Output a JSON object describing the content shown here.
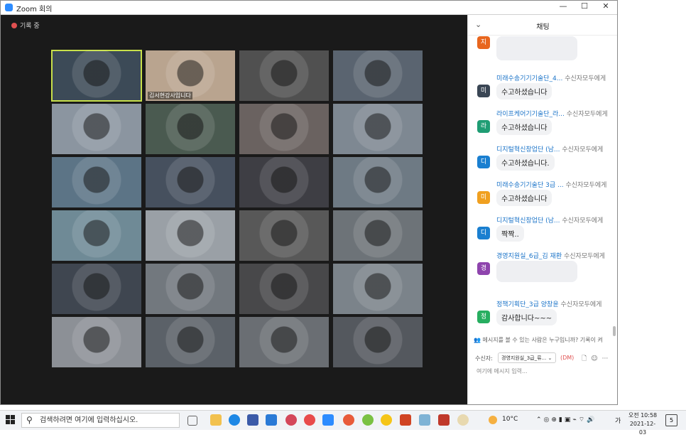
{
  "window": {
    "title": "Zoom 회의",
    "minimize": "—",
    "maximize": "☐",
    "close": "✕"
  },
  "meeting": {
    "recording_label": "기록 중",
    "featured_name": "김서현강사입니다",
    "tiles": [
      {
        "name": "",
        "color": "#3c4a57"
      },
      {
        "name": "김서현강사입니다",
        "color": "#b9a48f"
      },
      {
        "name": "",
        "color": "#505050"
      },
      {
        "name": "",
        "color": "#5a6470"
      },
      {
        "name": "",
        "color": "#8b95a0"
      },
      {
        "name": "",
        "color": "#4a5a50"
      },
      {
        "name": "",
        "color": "#6a6260"
      },
      {
        "name": "",
        "color": "#7e8892"
      },
      {
        "name": "",
        "color": "#5c7486"
      },
      {
        "name": "",
        "color": "#46505e"
      },
      {
        "name": "",
        "color": "#3e3e44"
      },
      {
        "name": "",
        "color": "#6e7a84"
      },
      {
        "name": "",
        "color": "#6f8a96"
      },
      {
        "name": "",
        "color": "#9aa0a6"
      },
      {
        "name": "",
        "color": "#585858"
      },
      {
        "name": "",
        "color": "#6d7378"
      },
      {
        "name": "",
        "color": "#3f4650"
      },
      {
        "name": "",
        "color": "#72787e"
      },
      {
        "name": "",
        "color": "#48484a"
      },
      {
        "name": "",
        "color": "#7b838a"
      },
      {
        "name": "",
        "color": "#8c9096"
      },
      {
        "name": "",
        "color": "#5b6168"
      },
      {
        "name": "",
        "color": "#6a6e73"
      },
      {
        "name": "",
        "color": "#54585e"
      }
    ]
  },
  "chat": {
    "title": "채팅",
    "messages": [
      {
        "avatar": "지",
        "color": "#e8661e",
        "sender": "",
        "to": "",
        "text": ""
      },
      {
        "avatar": "미",
        "color": "#3a4654",
        "sender": "미래수송기기기술단_4...",
        "to": "수신자모두에게",
        "text": "수고하셨습니다"
      },
      {
        "avatar": "라",
        "color": "#1f9d74",
        "sender": "라이프케어기기술단_라...",
        "to": "수신자모두에게",
        "text": "수고하셨습니다"
      },
      {
        "avatar": "디",
        "color": "#1a7fd0",
        "sender": "디지털혁신창업단 (남...",
        "to": "수신자모두에게",
        "text": "수고하셨습니다."
      },
      {
        "avatar": "미",
        "color": "#f0a020",
        "sender": "미래수송기기술단 3급 ...",
        "to": "수신자모두에게",
        "text": "수고하셨습니다"
      },
      {
        "avatar": "디",
        "color": "#1a7fd0",
        "sender": "디지털혁신창업단 (남...",
        "to": "수신자모두에게",
        "text": "짝짝.."
      },
      {
        "avatar": "경",
        "color": "#8e44ad",
        "sender": "경영지원실_6급_김 재환",
        "to": "수신자모두에게",
        "text": ""
      },
      {
        "avatar": "정",
        "color": "#27ae60",
        "sender": "정책기획단_3급 양창윤",
        "to": "수신자모두에게",
        "text": "감사합니다~~~"
      }
    ],
    "notice": "메시지를 볼 수 있는 사람은 누구입니까? 기록이 켜",
    "recipient_label": "수신자:",
    "recipient_value": "경영지원실_3급_류...",
    "dm": "(DM)",
    "input_placeholder": "여기에 메시지 입력..."
  },
  "taskbar": {
    "search_placeholder": "검색하려면 여기에 입력하십시오.",
    "weather": "10°C",
    "ime": "가",
    "time": "오전 10:58",
    "date": "2021-12-03",
    "notifications": "5"
  }
}
